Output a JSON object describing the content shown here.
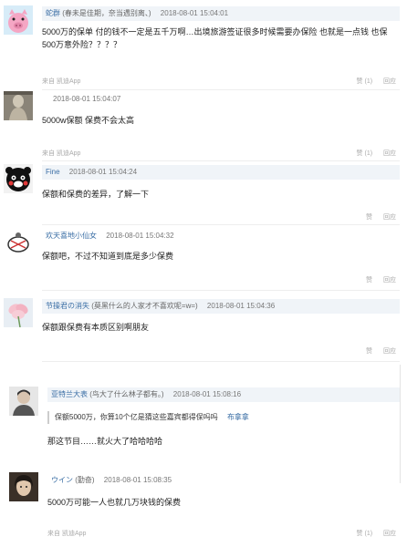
{
  "comments": [
    {
      "user": "蛇群",
      "signature": "(春未是佳期，奈当遇别离、)",
      "time": "2018-08-01 15:04:01",
      "text": "5000万的保单 付的钱不一定是五千万啊…出境旅游签证很多时候需要办保险 也就是一点钱 也保500万意外险？？？？",
      "source": "来自 凯迪App",
      "like": "赞 (1)",
      "reply": "回应"
    },
    {
      "user": "",
      "signature": "",
      "time": "2018-08-01 15:04:07",
      "text": "5000w保额 保费不会太高",
      "source": "来自 凯迪App",
      "like": "赞 (1)",
      "reply": "回应"
    },
    {
      "user": "Fine",
      "signature": "",
      "time": "2018-08-01 15:04:24",
      "text": "保额和保费的差异，了解一下",
      "source": "",
      "like": "赞",
      "reply": "回应"
    },
    {
      "user": "欢天喜地小仙女",
      "signature": "",
      "time": "2018-08-01 15:04:32",
      "text": "保额吧，不过不知道到底是多少保费",
      "source": "",
      "like": "赞",
      "reply": "回应"
    },
    {
      "user": "节操君の消失",
      "signature": "(莫黑什么的人家才不喜欢呢=w=)",
      "time": "2018-08-01 15:04:36",
      "text": "保额跟保费有本质区别啊朋友",
      "source": "",
      "like": "赞",
      "reply": "回应"
    },
    {
      "user": "亚特兰大表",
      "signature": "(鸟大了什么林子都有。)",
      "time": "2018-08-01 15:08:16",
      "quote": "保额5000万，你算10个亿是猜这些嘉宾都得保吗吗",
      "quote_author": "布拿拿",
      "text": "那这节目……就火大了哈哈哈哈",
      "source": "",
      "like": "",
      "reply": ""
    },
    {
      "user": "ウイン",
      "signature": "(勤奋)",
      "time": "2018-08-01 15:08:35",
      "text": "5000万可能一人也就几万块钱的保费",
      "source": "来自 凯迪App",
      "like": "赞 (1)",
      "reply": "回应"
    }
  ],
  "colors": {
    "link": "#3a6ea5",
    "meta_bg": "#f0f4f8",
    "muted": "#aaaaaa"
  }
}
